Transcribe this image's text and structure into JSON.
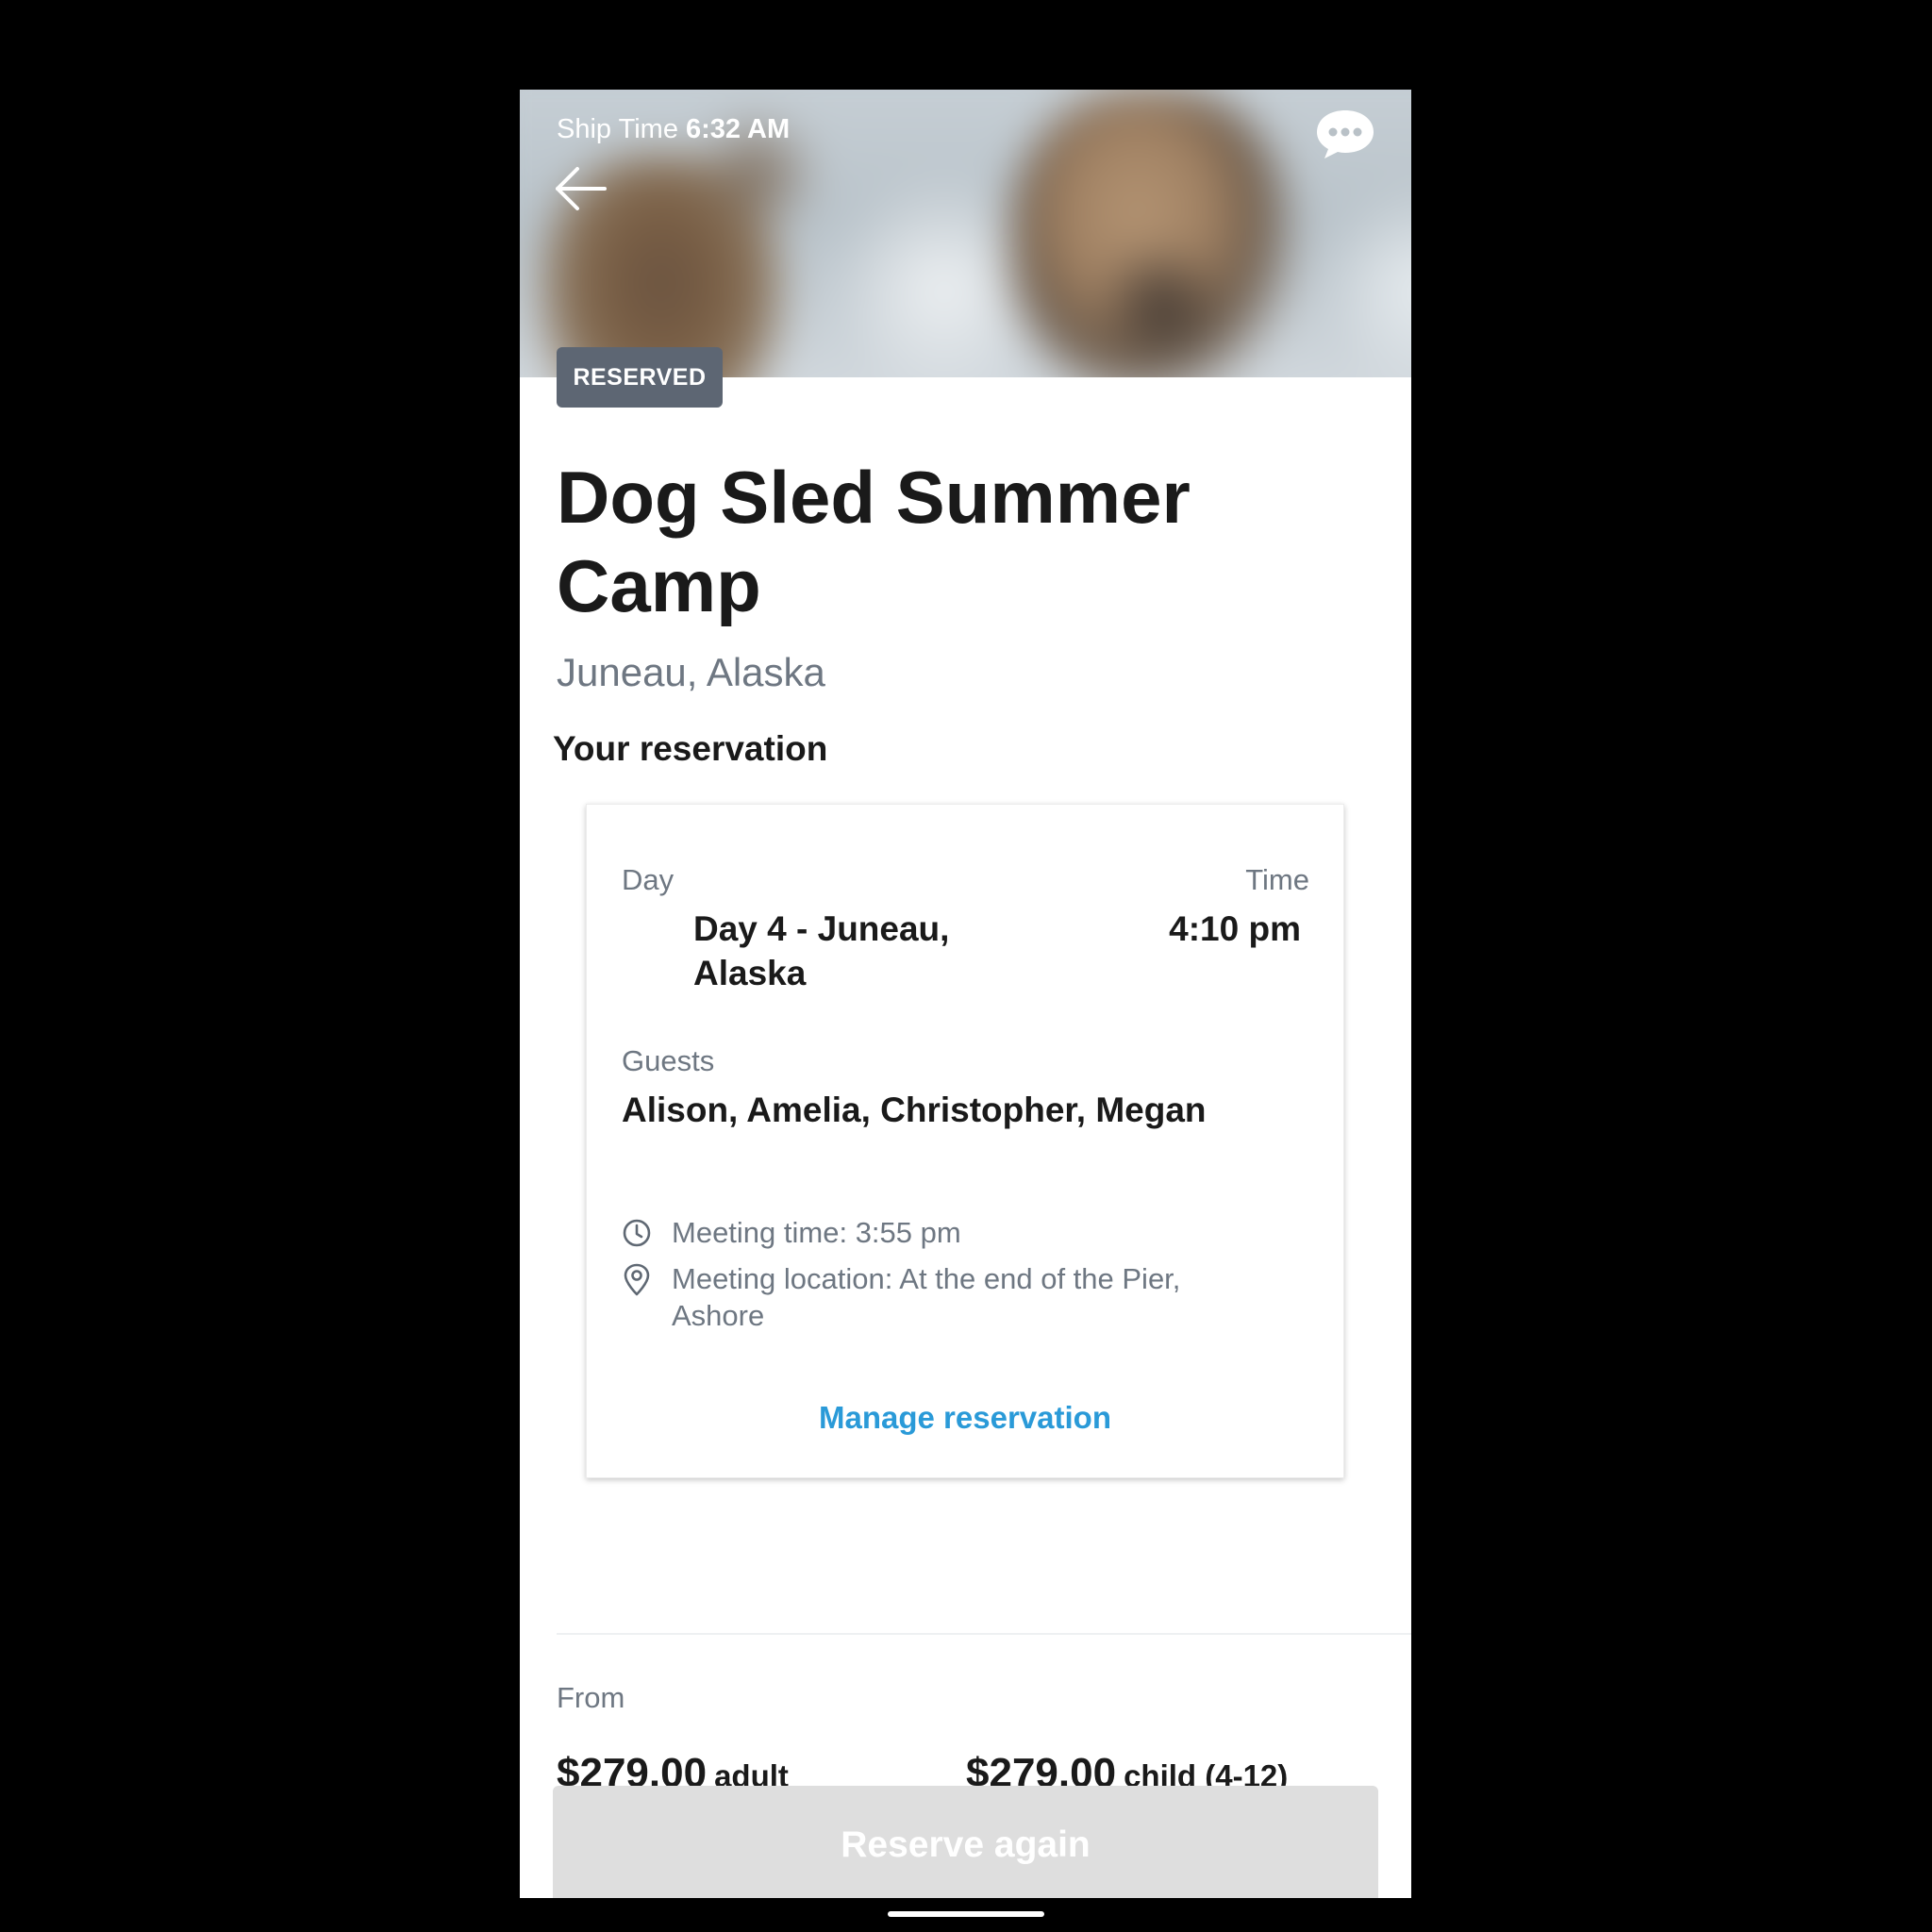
{
  "header": {
    "ship_time_label": "Ship Time",
    "ship_time_value": "6:32 AM"
  },
  "icons": {
    "back": "arrow-left-icon",
    "chat": "chat-bubble-icon",
    "clock": "clock-icon",
    "location": "location-pin-icon"
  },
  "badge": "RESERVED",
  "title": "Dog Sled Summer Camp",
  "location": "Juneau, Alaska",
  "reservation": {
    "section_title": "Your reservation",
    "day_label": "Day",
    "day_value": "Day 4 - Juneau, Alaska",
    "time_label": "Time",
    "time_value": "4:10 pm",
    "guests_label": "Guests",
    "guests_value": "Alison, Amelia, Christopher, Megan",
    "meeting_time": "Meeting time: 3:55 pm",
    "meeting_location": "Meeting location: At the end of the Pier, Ashore",
    "manage_link": "Manage reservation"
  },
  "pricing": {
    "from_label": "From",
    "adult_price": "$279.00",
    "adult_unit": "adult",
    "child_price": "$279.00",
    "child_unit": "child (4-12)"
  },
  "actions": {
    "reserve_again": "Reserve again"
  },
  "colors": {
    "badge_bg": "#5d6673",
    "link": "#2a9ad8",
    "muted_text": "#6e7782",
    "disabled_button": "#dedede"
  }
}
